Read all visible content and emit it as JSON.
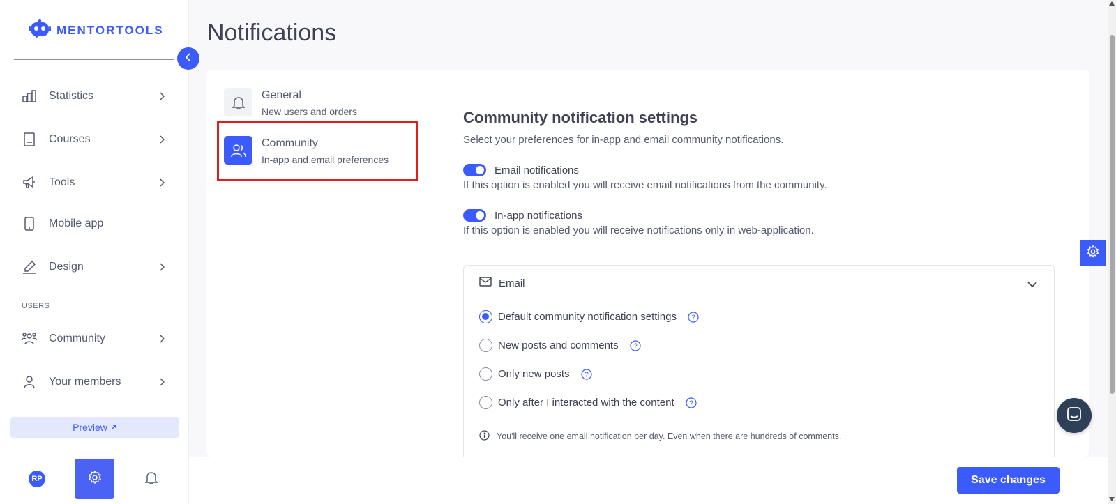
{
  "brand": {
    "name": "MENTORTOOLS",
    "accent": "#3b5bfd"
  },
  "page": {
    "title": "Notifications"
  },
  "sidebar": {
    "items": [
      {
        "label": "Statistics",
        "icon": "bar-chart-icon",
        "has_chevron": true
      },
      {
        "label": "Courses",
        "icon": "book-icon",
        "has_chevron": true
      },
      {
        "label": "Tools",
        "icon": "megaphone-icon",
        "has_chevron": true
      },
      {
        "label": "Mobile app",
        "icon": "mobile-icon",
        "has_chevron": false
      },
      {
        "label": "Design",
        "icon": "pencil-icon",
        "has_chevron": true
      }
    ],
    "section_label": "USERS",
    "user_items": [
      {
        "label": "Community",
        "icon": "users-icon",
        "has_chevron": true
      },
      {
        "label": "Your members",
        "icon": "user-icon",
        "has_chevron": true
      }
    ],
    "preview_label": "Preview",
    "avatar_initials": "RP"
  },
  "menu": {
    "items": [
      {
        "title": "General",
        "subtitle": "New users and orders",
        "icon": "bell-icon",
        "selected": false
      },
      {
        "title": "Community",
        "subtitle": "In-app and email preferences",
        "icon": "users-icon",
        "selected": true
      }
    ]
  },
  "settings": {
    "title": "Community notification settings",
    "description": "Select your preferences for in-app and email community notifications.",
    "toggles": [
      {
        "label": "Email notifications",
        "help": "If this option is enabled you will receive email notifications from the community.",
        "enabled": true
      },
      {
        "label": "In-app notifications",
        "help": "If this option is enabled you will receive notifications only in web-application.",
        "enabled": true
      }
    ],
    "email_section": {
      "title": "Email",
      "options": [
        {
          "label": "Default community notification settings",
          "checked": true
        },
        {
          "label": "New posts and comments",
          "checked": false
        },
        {
          "label": "Only new posts",
          "checked": false
        },
        {
          "label": "Only after I interacted with the content",
          "checked": false
        }
      ],
      "info": "You'll receive one email notification per day. Even when there are hundreds of comments."
    }
  },
  "footer": {
    "save_label": "Save changes"
  }
}
